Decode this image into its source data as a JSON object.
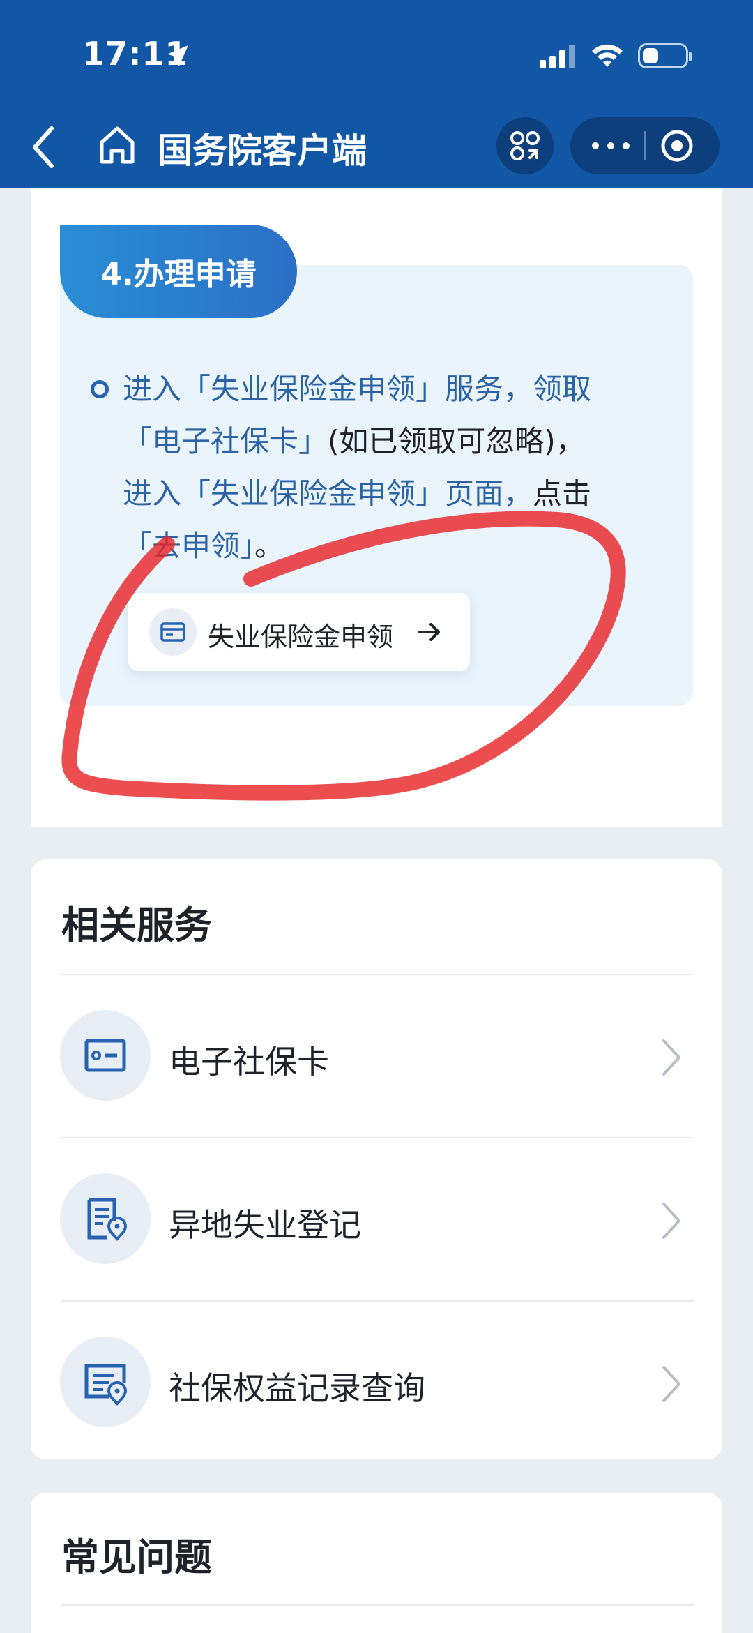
{
  "status_bar": {
    "time": "17:11"
  },
  "nav": {
    "title": "国务院客户端"
  },
  "step": {
    "badge": "4.办理申请",
    "text_segments": [
      {
        "text": "进入「失业保险金申领」服务，领取",
        "highlight": true
      },
      {
        "text": "「电子社保卡」",
        "highlight": true
      },
      {
        "text": "(如已领取可忽略)，",
        "highlight": false
      },
      {
        "text": "进入「失业保险金申领」页面，",
        "highlight": true
      },
      {
        "text": "点击",
        "highlight": false
      },
      {
        "text": "「去申领」",
        "highlight": true
      },
      {
        "text": "。",
        "highlight": false
      }
    ],
    "link_label": "失业保险金申领"
  },
  "related": {
    "title": "相关服务",
    "items": [
      {
        "label": "电子社保卡",
        "icon": "id-card-icon"
      },
      {
        "label": "异地失业登记",
        "icon": "document-location-icon"
      },
      {
        "label": "社保权益记录查询",
        "icon": "record-location-icon"
      }
    ]
  },
  "faq": {
    "title": "常见问题"
  },
  "colors": {
    "header_bg": "#1157a6",
    "accent_text": "#2c63a5",
    "annotation_red": "#e8272a"
  }
}
